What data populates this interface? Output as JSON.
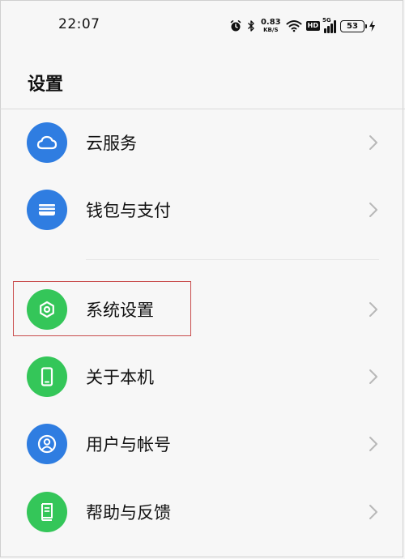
{
  "status_bar": {
    "time": "22:07",
    "net_speed_value": "0.83",
    "net_speed_unit": "KB/S",
    "hd_label": "HD",
    "network_type": "5G",
    "battery_level": "53",
    "icons": [
      "alarm-icon",
      "bluetooth-icon",
      "wifi-icon",
      "hd-icon",
      "signal-icon",
      "battery-icon",
      "charging-icon"
    ]
  },
  "header": {
    "title": "设置"
  },
  "menu": {
    "items": [
      {
        "label": "云服务",
        "icon": "cloud-icon",
        "color": "#2f7de1"
      },
      {
        "label": "钱包与支付",
        "icon": "wallet-icon",
        "color": "#2f7de1"
      },
      {
        "label": "系统设置",
        "icon": "gear-icon",
        "color": "#34c659"
      },
      {
        "label": "关于本机",
        "icon": "phone-icon",
        "color": "#34c659"
      },
      {
        "label": "用户与帐号",
        "icon": "user-icon",
        "color": "#2f7de1"
      },
      {
        "label": "帮助与反馈",
        "icon": "book-icon",
        "color": "#34c659"
      }
    ]
  },
  "colors": {
    "blue_accent": "#2f7de1",
    "green_accent": "#34c659",
    "highlight_border": "#c94c4c"
  }
}
